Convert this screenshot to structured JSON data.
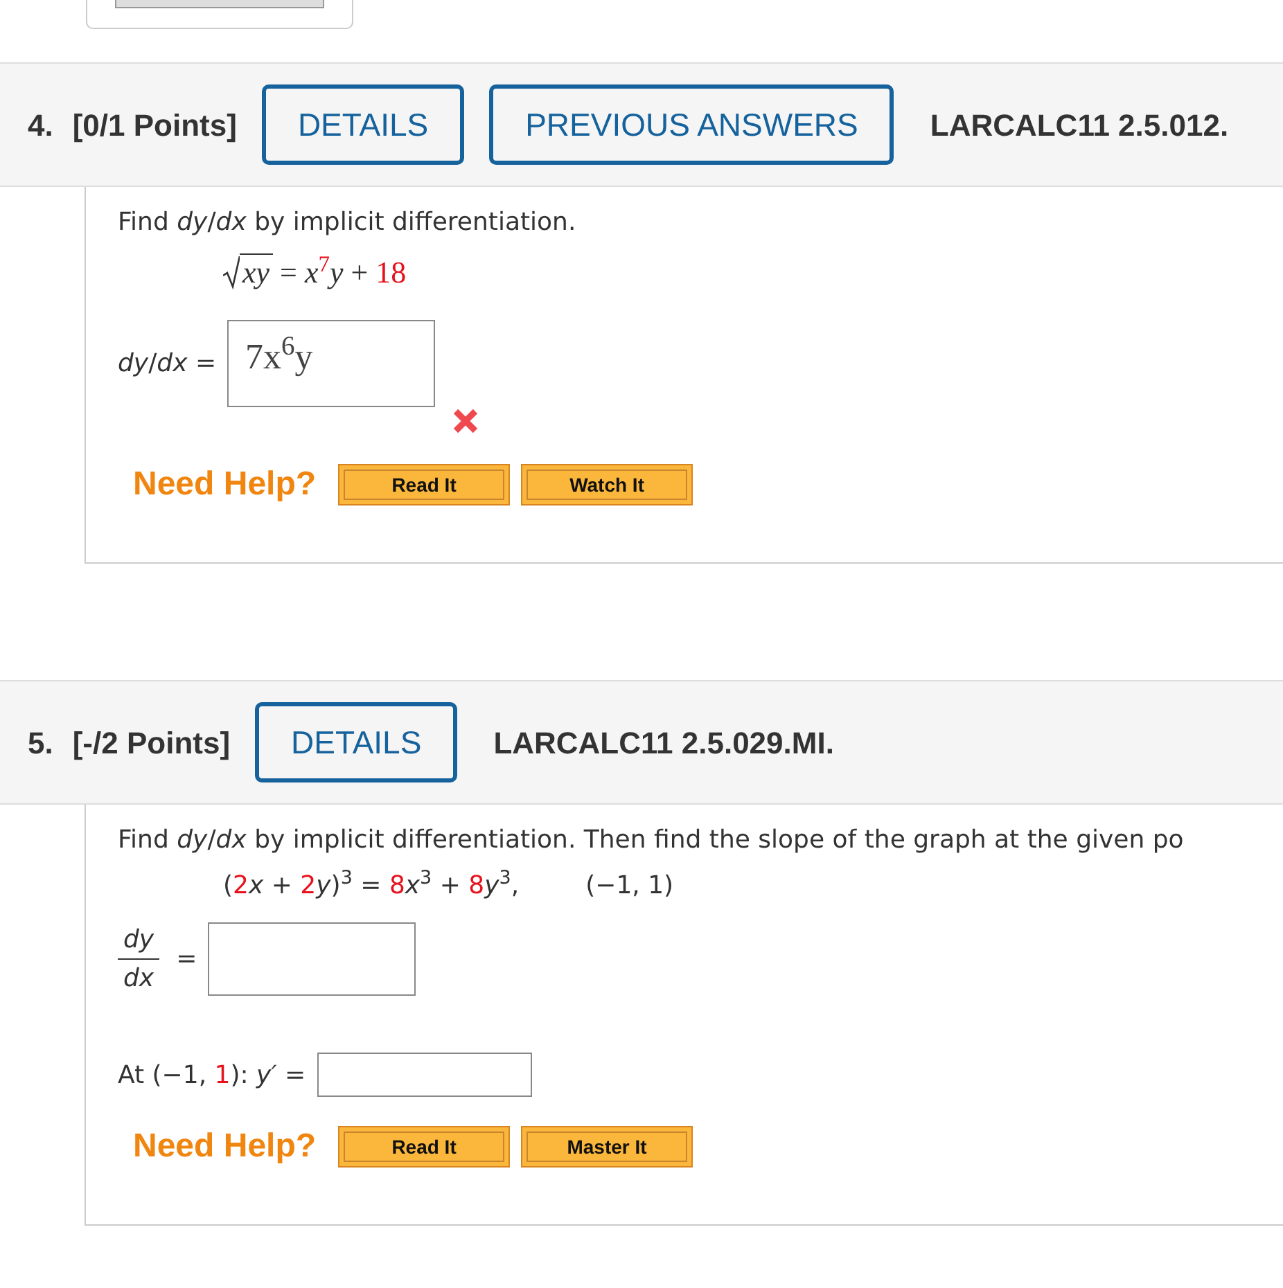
{
  "questions": [
    {
      "number": "4.",
      "points": "[0/1 Points]",
      "buttons": [
        "DETAILS",
        "PREVIOUS ANSWERS"
      ],
      "code": "LARCALC11 2.5.012.",
      "prompt": "Find *dy*/*dx* by implicit differentiation.",
      "equation": [
        {
          "kind": "root",
          "text": "xy",
          "red": false
        },
        {
          "kind": "text",
          "text": " = x",
          "red": false
        },
        {
          "kind": "sup",
          "text": "7",
          "red": true
        },
        {
          "kind": "text",
          "text": "y + ",
          "red": false
        },
        {
          "kind": "text",
          "text": "18",
          "red": true
        }
      ],
      "answers": [
        {
          "kind": "inline",
          "label": [
            {
              "text": "*dy*/*dx* =",
              "red": false
            }
          ],
          "value": "7x$^{6}$y",
          "correct": false
        }
      ],
      "help_label": "Need Help?",
      "help_buttons": [
        "Read It",
        "Watch It"
      ]
    },
    {
      "number": "5.",
      "points": "[-/2 Points]",
      "buttons": [
        "DETAILS"
      ],
      "code": "LARCALC11 2.5.029.MI.",
      "prompt": "Find *dy*/*dx* by implicit differentiation. Then find the slope of the graph at the given po",
      "equation": [
        {
          "kind": "text",
          "text": "(",
          "red": false
        },
        {
          "kind": "text",
          "text": "2",
          "red": true
        },
        {
          "kind": "text",
          "text": "*x* + ",
          "red": false
        },
        {
          "kind": "text",
          "text": "2",
          "red": true
        },
        {
          "kind": "text",
          "text": "*y*)",
          "red": false
        },
        {
          "kind": "sup",
          "text": "3",
          "red": false
        },
        {
          "kind": "text",
          "text": " = ",
          "red": false
        },
        {
          "kind": "text",
          "text": "8",
          "red": true
        },
        {
          "kind": "text",
          "text": "*x*",
          "red": false
        },
        {
          "kind": "sup",
          "text": "3",
          "red": false
        },
        {
          "kind": "text",
          "text": " + ",
          "red": false
        },
        {
          "kind": "text",
          "text": "8",
          "red": true
        },
        {
          "kind": "text",
          "text": "*y*",
          "red": false
        },
        {
          "kind": "sup",
          "text": "3",
          "red": false
        },
        {
          "kind": "text",
          "text": ",",
          "red": false
        }
      ],
      "point": "(−1, 1)",
      "answers": [
        {
          "kind": "fraction",
          "numerator": "dy",
          "denominator": "dx",
          "equals": "="
        },
        {
          "kind": "inline",
          "label": [
            {
              "text": "At (−1, ",
              "red": false
            },
            {
              "text": "1",
              "red": true
            },
            {
              "text": "): *y′* =",
              "red": false
            }
          ]
        }
      ],
      "help_label": "Need Help?",
      "help_buttons": [
        "Read It",
        "Master It"
      ]
    }
  ]
}
